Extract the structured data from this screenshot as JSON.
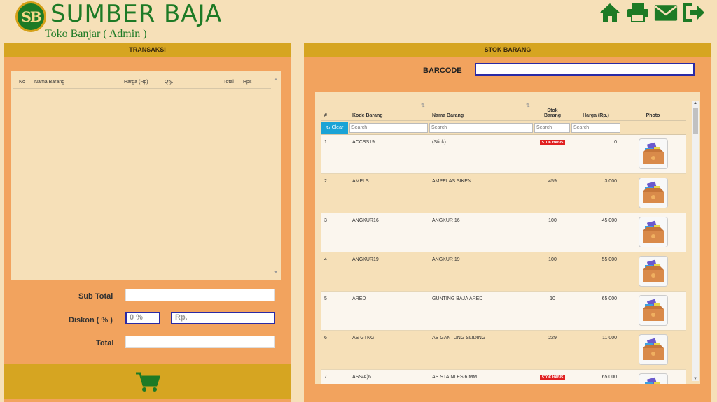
{
  "brand": {
    "logo_text": "SB",
    "name": "SUMBER BAJA",
    "subtitle": "Toko Banjar ( Admin )"
  },
  "top_icons": [
    "home-icon",
    "print-icon",
    "mail-icon",
    "logout-icon"
  ],
  "colors": {
    "brand_green": "#1d7a25",
    "header_gold": "#d6a521",
    "panel_orange": "#f2a35e",
    "panel_cream": "#f6e0b8",
    "badge_red": "#e02020",
    "clear_blue": "#1aa3d6"
  },
  "transaksi": {
    "title": "TRANSAKSI",
    "columns": [
      "No",
      "Nama Barang",
      "Harga (Rp)",
      "Qty.",
      "Total",
      "Hps"
    ],
    "sub_total_label": "Sub Total",
    "sub_total_value": "",
    "diskon_label": "Diskon ( % )",
    "diskon_percent_placeholder": "0 %",
    "diskon_rp_placeholder": "Rp.",
    "total_label": "Total",
    "total_value": ""
  },
  "stok": {
    "title": "STOK BARANG",
    "barcode_label": "BARCODE",
    "barcode_value": "",
    "columns": {
      "no": "#",
      "kode": "Kode Barang",
      "nama": "Nama Barang",
      "stok_line1": "Stok",
      "stok_line2": "Barang",
      "harga": "Harga (Rp.)",
      "photo": "Photo"
    },
    "clear_label": "Clear",
    "search_placeholder": "Search",
    "rows": [
      {
        "no": "1",
        "kode": "ACCSS19",
        "nama": "(Stick)",
        "stok": "STOK HABIS",
        "habis": true,
        "harga": "0"
      },
      {
        "no": "2",
        "kode": "AMPLS",
        "nama": "AMPELAS SIKEN",
        "stok": "459",
        "habis": false,
        "harga": "3.000"
      },
      {
        "no": "3",
        "kode": "ANGKUR16",
        "nama": "ANGKUR 16",
        "stok": "100",
        "habis": false,
        "harga": "45.000"
      },
      {
        "no": "4",
        "kode": "ANGKUR19",
        "nama": "ANGKUR 19",
        "stok": "100",
        "habis": false,
        "harga": "55.000"
      },
      {
        "no": "5",
        "kode": "ARED",
        "nama": "GUNTING BAJA ARED",
        "stok": "10",
        "habis": false,
        "harga": "65.000"
      },
      {
        "no": "6",
        "kode": "AS GTNG",
        "nama": "AS GANTUNG SLIDING",
        "stok": "229",
        "habis": false,
        "harga": "11.000"
      },
      {
        "no": "7",
        "kode": "ASS/A)6",
        "nama": "AS STAINLES 6 MM",
        "stok": "STOK HABIS",
        "habis": true,
        "harga": "65.000"
      }
    ]
  }
}
